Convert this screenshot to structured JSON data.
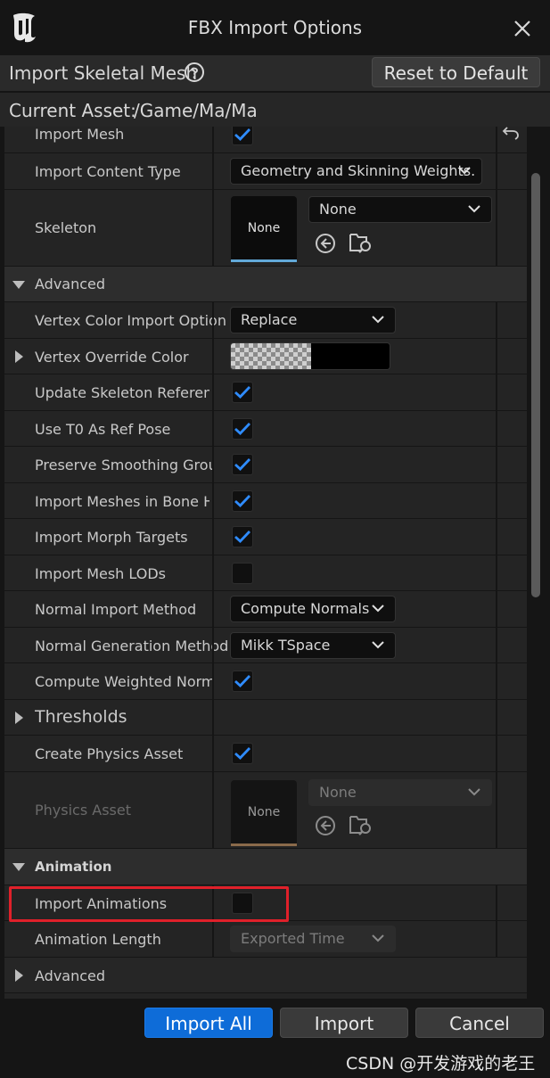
{
  "window": {
    "title": "FBX Import Options"
  },
  "header": {
    "section_label": "Import Skeletal Mesh",
    "reset_label": "Reset to Default",
    "current_asset_label": "Current Asset:",
    "current_asset_path": "/Game/Ma/Ma"
  },
  "rows": {
    "import_mesh": {
      "label": "Import Mesh",
      "checked": true
    },
    "import_content_type": {
      "label": "Import Content Type",
      "value": "Geometry and Skinning Weights."
    },
    "skeleton": {
      "label": "Skeleton",
      "thumb_text": "None",
      "value": "None"
    },
    "advanced": {
      "label": "Advanced"
    },
    "vertex_color_import_option": {
      "label": "Vertex Color Import Option",
      "value": "Replace"
    },
    "vertex_override_color": {
      "label": "Vertex Override Color",
      "color": "#000000"
    },
    "update_skeleton_reference": {
      "label": "Update Skeleton Referenc...",
      "checked": true
    },
    "use_t0_as_ref_pose": {
      "label": "Use T0 As Ref Pose",
      "checked": true
    },
    "preserve_smoothing_groups": {
      "label": "Preserve Smoothing Groups",
      "checked": true
    },
    "import_meshes_in_bone_hierarchy": {
      "label": "Import Meshes in Bone Hi...",
      "checked": true
    },
    "import_morph_targets": {
      "label": "Import Morph Targets",
      "checked": true
    },
    "import_mesh_lods": {
      "label": "Import Mesh LODs",
      "checked": false
    },
    "normal_import_method": {
      "label": "Normal Import Method",
      "value": "Compute Normals"
    },
    "normal_generation_method": {
      "label": "Normal Generation Method",
      "value": "Mikk TSpace"
    },
    "compute_weighted_normals": {
      "label": "Compute Weighted Normals",
      "checked": true
    },
    "thresholds": {
      "label": "Thresholds"
    },
    "create_physics_asset": {
      "label": "Create Physics Asset",
      "checked": true
    },
    "physics_asset": {
      "label": "Physics Asset",
      "thumb_text": "None",
      "value": "None"
    },
    "animation": {
      "label": "Animation"
    },
    "import_animations": {
      "label": "Import Animations",
      "checked": false
    },
    "animation_length": {
      "label": "Animation Length",
      "value": "Exported Time"
    },
    "advanced2": {
      "label": "Advanced"
    }
  },
  "footer": {
    "import_all_label": "Import All",
    "import_label": "Import",
    "cancel_label": "Cancel"
  },
  "watermark": "CSDN @开发游戏的老王",
  "colors": {
    "accent": "#0e6cd8",
    "check": "#2f8cff",
    "highlight": "#e0202a",
    "skeleton_bar": "#62a9d8",
    "physics_bar": "#8a6a4a"
  }
}
